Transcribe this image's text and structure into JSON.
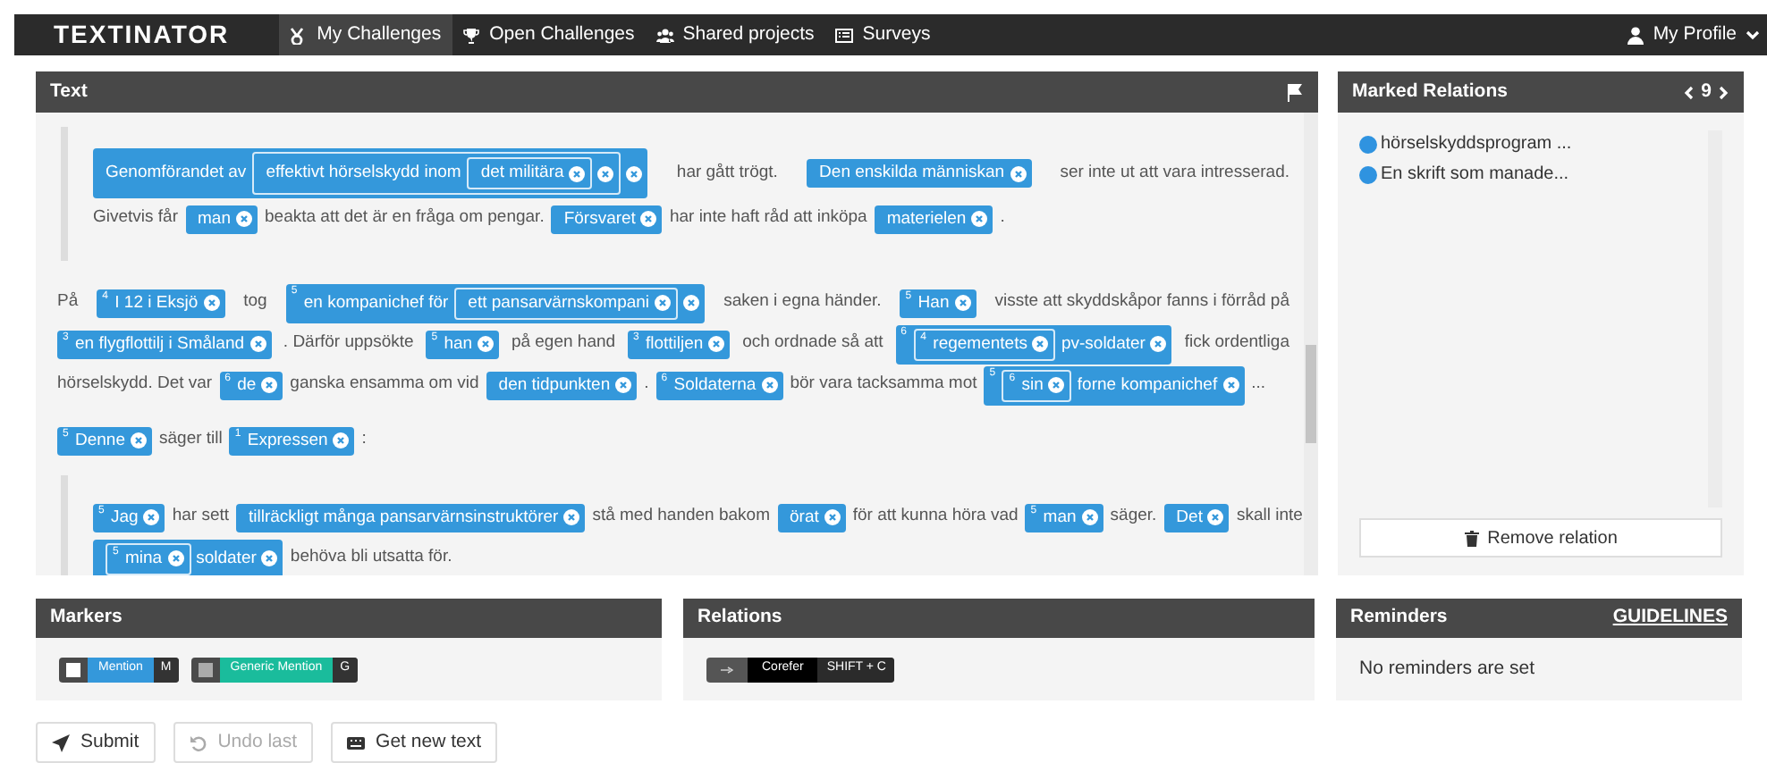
{
  "nav": {
    "logo": "TEXTINATOR",
    "items": [
      {
        "label": "My Challenges",
        "selected": true,
        "kind": "challenges"
      },
      {
        "label": "Open Challenges",
        "selected": false,
        "kind": "trophy"
      },
      {
        "label": "Shared projects",
        "selected": false,
        "kind": "users"
      },
      {
        "label": "Surveys",
        "selected": false,
        "kind": "surveys"
      }
    ],
    "profile": "My Profile"
  },
  "text_panel": {
    "title": "Text",
    "paragraphs": [
      {
        "kind": "quote",
        "lines": [
          {
            "segments": [
              {
                "parts": [
                  "Genomförandet av",
                  {
                    "parts": [
                      "effektivt hörselskydd inom",
                      {
                        "parts": [
                          "det militära"
                        ]
                      }
                    ]
                  }
                ]
              },
              "har gått trögt.",
              {
                "parts": [
                  "Den enskilda människan"
                ]
              },
              "ser inte ut att vara intresserad."
            ]
          },
          {
            "segments": [
              "Givetvis får",
              {
                "parts": [
                  "man"
                ]
              },
              "beakta att det är en fråga om pengar.",
              {
                "parts": [
                  "Försvaret"
                ]
              },
              "har inte haft råd att inköpa",
              {
                "parts": [
                  "materielen"
                ]
              },
              "."
            ]
          }
        ]
      },
      {
        "kind": "plain",
        "lines": [
          {
            "segments": [
              "På",
              {
                "number": "4",
                "parts": [
                  "I 12 i Eksjö"
                ]
              },
              "tog",
              {
                "number": "5",
                "parts": [
                  "en kompanichef för",
                  {
                    "parts": [
                      "ett pansarvärnskompani"
                    ]
                  }
                ]
              },
              "saken i egna händer.",
              {
                "number": "5",
                "parts": [
                  "Han"
                ]
              },
              "visste att skyddskåpor fanns i förråd på"
            ]
          },
          {
            "segments": [
              {
                "number": "3",
                "parts": [
                  "en flygflottilj i Småland"
                ]
              },
              ". Därför uppsökte",
              {
                "number": "5",
                "parts": [
                  "han"
                ]
              },
              "på egen hand",
              {
                "number": "3",
                "parts": [
                  "flottiljen"
                ]
              },
              "och ordnade så att",
              {
                "number": "6",
                "parts": [
                  {
                    "number": "4",
                    "parts": [
                      "regementets"
                    ]
                  },
                  "pv-soldater"
                ]
              },
              "fick ordentliga"
            ]
          },
          {
            "segments": [
              "hörselskydd. Det var",
              {
                "number": "6",
                "parts": [
                  "de"
                ]
              },
              "ganska ensamma om vid",
              {
                "parts": [
                  "den tidpunkten"
                ]
              },
              ".",
              {
                "number": "6",
                "parts": [
                  "Soldaterna"
                ]
              },
              "bör vara tacksamma mot",
              {
                "number": "5",
                "parts": [
                  {
                    "number": "6",
                    "parts": [
                      "sin"
                    ]
                  },
                  "forne kompanichef"
                ]
              },
              "..."
            ]
          }
        ]
      },
      {
        "kind": "plain",
        "lines": [
          {
            "segments": [
              {
                "number": "5",
                "parts": [
                  "Denne"
                ]
              },
              "säger till",
              {
                "number": "1",
                "parts": [
                  "Expressen"
                ]
              },
              ":"
            ]
          }
        ]
      },
      {
        "kind": "quote",
        "lines": [
          {
            "segments": [
              {
                "number": "5",
                "parts": [
                  "Jag"
                ]
              },
              "har sett",
              {
                "parts": [
                  "tillräckligt många pansarvärnsinstruktörer"
                ]
              },
              "stå med handen bakom",
              {
                "parts": [
                  "örat"
                ]
              },
              "för att kunna höra vad",
              {
                "number": "5",
                "parts": [
                  "man"
                ]
              },
              "säger.",
              {
                "parts": [
                  "Det"
                ]
              },
              "skall inte"
            ]
          },
          {
            "segments": [
              {
                "parts": [
                  {
                    "number": "5",
                    "parts": [
                      "mina"
                    ]
                  },
                  "soldater"
                ]
              },
              "behöva bli utsatta för."
            ]
          }
        ]
      }
    ]
  },
  "marked_relations": {
    "title": "Marked Relations",
    "count": "9",
    "items": [
      {
        "label": "hörselskyddsprogram ...",
        "color": "#2f93e0"
      },
      {
        "label": "En skrift som manade...",
        "color": "#2f93e0"
      }
    ],
    "remove_button": "Remove relation"
  },
  "markers": {
    "title": "Markers",
    "items": [
      {
        "label": "Mention",
        "key": "M",
        "color": "#3498db",
        "highlighted": true
      },
      {
        "label": "Generic Mention",
        "key": "G",
        "color": "#1abc9c",
        "highlighted": false
      }
    ]
  },
  "relations": {
    "title": "Relations",
    "items": [
      {
        "label": "Corefer",
        "key": "SHIFT + C"
      }
    ]
  },
  "reminders": {
    "title": "Reminders",
    "link": "GUIDELINES",
    "empty_text": "No reminders are set"
  },
  "actions": [
    {
      "label": "Submit",
      "kind": "submit",
      "disabled": false
    },
    {
      "label": "Undo last",
      "kind": "undo",
      "disabled": true
    },
    {
      "label": "Get new text",
      "kind": "new-text",
      "disabled": false
    }
  ]
}
